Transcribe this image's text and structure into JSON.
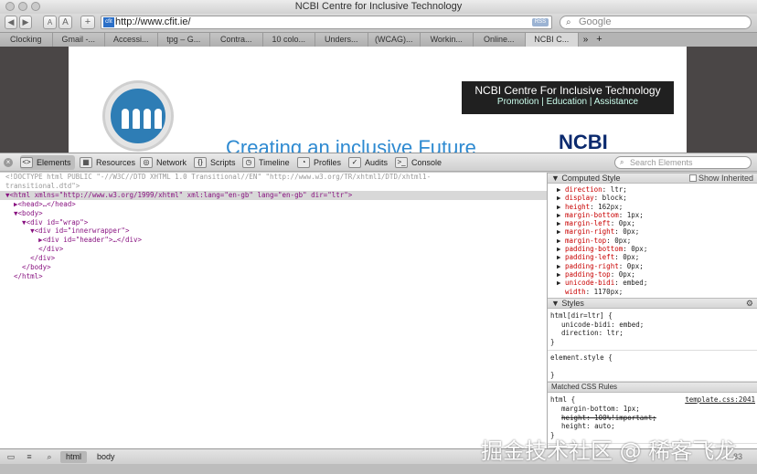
{
  "window": {
    "title": "NCBI Centre for Inclusive Technology"
  },
  "toolbar": {
    "back_label": "◀",
    "forward_label": "▶",
    "font_small": "A",
    "font_large": "A",
    "add_label": "+",
    "favicon_text": "cfit",
    "url": "http://www.cfit.ie/",
    "rss_label": "RSS",
    "search_placeholder": "Google"
  },
  "tabs": [
    {
      "label": "Clocking"
    },
    {
      "label": "Gmail -..."
    },
    {
      "label": "Accessi..."
    },
    {
      "label": "tpg – G..."
    },
    {
      "label": "Contra..."
    },
    {
      "label": "10 colo..."
    },
    {
      "label": "Unders..."
    },
    {
      "label": "(WCAG)..."
    },
    {
      "label": "Workin..."
    },
    {
      "label": "Online..."
    },
    {
      "label": "NCBI C..."
    }
  ],
  "tabs_more": "»",
  "tabs_add": "+",
  "page": {
    "banner_title": "NCBI Centre  For Inclusive Technology",
    "banner_sub": "Promotion | Education | Assistance",
    "tagline": "Creating an inclusive Future",
    "logo_text": "NCBI"
  },
  "devtools": {
    "close_label": "×",
    "panels": [
      {
        "label": "Elements",
        "icon": "<>"
      },
      {
        "label": "Resources",
        "icon": "▦"
      },
      {
        "label": "Network",
        "icon": "◎"
      },
      {
        "label": "Scripts",
        "icon": "{}"
      },
      {
        "label": "Timeline",
        "icon": "◷"
      },
      {
        "label": "Profiles",
        "icon": "◔"
      },
      {
        "label": "Audits",
        "icon": "✓"
      },
      {
        "label": "Console",
        "icon": ">_"
      }
    ],
    "search_placeholder": "Search Elements"
  },
  "dom_lines": [
    "<!DOCTYPE html PUBLIC \"-//W3C//DTD XHTML 1.0 Transitional//EN\" \"http://www.w3.org/TR/xhtml1/DTD/xhtml1-",
    "transitional.dtd\">",
    "▼<html xmlns=\"http://www.w3.org/1999/xhtml\" xml:lang=\"en-gb\" lang=\"en-gb\" dir=\"ltr\">",
    "  ▶<head>…</head>",
    "  ▼<body>",
    "    ▼<div id=\"wrap\">",
    "      ▼<div id=\"innerwrapper\">",
    "        ▶<div id=\"header\">…</div>",
    "        </div>",
    "      </div>",
    "    </body>",
    "  </html>"
  ],
  "sidebar": {
    "computed_title": "Computed Style",
    "show_inherited": "Show Inherited",
    "computed": [
      {
        "name": "direction",
        "value": "ltr;"
      },
      {
        "name": "display",
        "value": "block;"
      },
      {
        "name": "height",
        "value": "162px;"
      },
      {
        "name": "margin-bottom",
        "value": "1px;"
      },
      {
        "name": "margin-left",
        "value": "0px;"
      },
      {
        "name": "margin-right",
        "value": "0px;"
      },
      {
        "name": "margin-top",
        "value": "0px;"
      },
      {
        "name": "padding-bottom",
        "value": "0px;"
      },
      {
        "name": "padding-left",
        "value": "0px;"
      },
      {
        "name": "padding-right",
        "value": "0px;"
      },
      {
        "name": "padding-top",
        "value": "0px;"
      },
      {
        "name": "unicode-bidi",
        "value": "embed;"
      },
      {
        "name": "width",
        "value": "1170px;"
      }
    ],
    "styles_title": "Styles",
    "rule1_selector": "html[dir=ltr] {",
    "rule1_props": [
      "unicode-bidi: embed;",
      "direction: ltr;"
    ],
    "rule1_close": "}",
    "element_style": "element.style {",
    "element_close": "}",
    "matched_title": "Matched CSS Rules",
    "rule2_selector": "html {",
    "rule2_source": "template.css:2041",
    "rule2_props": [
      "margin-bottom: 1px;",
      "height: 100%!important;",
      "height: auto;"
    ],
    "rule2_close": "}"
  },
  "statusbar": {
    "crumbs": [
      "html",
      "body"
    ],
    "error_count": "83"
  },
  "watermark": "掘金技术社区 @ 稀客飞龙"
}
